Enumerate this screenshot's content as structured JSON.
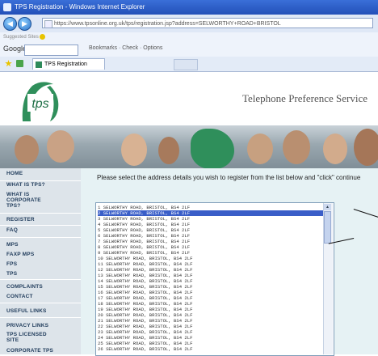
{
  "window": {
    "title": "TPS Registration - Windows Internet Explorer"
  },
  "browser": {
    "url": "https://www.tpsonline.org.uk/tps/registration.jsp?address=SELWORTHY+ROAD+BRISTOL",
    "links_label": "Suggested Sites",
    "google_label": "Google",
    "toolbar_items": "Bookmarks · Check · Options",
    "tab_title": "TPS Registration"
  },
  "site": {
    "logo_text": "tps",
    "title": "Telephone Preference Service"
  },
  "nav": {
    "items": [
      "HOME",
      "WHAT IS TPS?",
      "WHAT IS CORPORATE TPS?",
      "REGISTER",
      "FAQ",
      "MPS",
      "FAXP MPS",
      "FPS",
      "TPS",
      "COMPLAINTS",
      "CONTACT",
      "USEFUL LINKS",
      "PRIVACY LINKS",
      "TPS LICENSED SITE",
      "CORPORATE TPS"
    ]
  },
  "content": {
    "instruction": "Please select the address details you wish to register from the list below and \"click\" continue"
  },
  "address_list": {
    "selected_index": 1,
    "options": [
      "1 SELWORTHY ROAD, BRISTOL, BS4 2LF",
      "2 SELWORTHY ROAD, BRISTOL, BS4 2LF",
      "3 SELWORTHY ROAD, BRISTOL, BS4 2LF",
      "4 SELWORTHY ROAD, BRISTOL, BS4 2LF",
      "5 SELWORTHY ROAD, BRISTOL, BS4 2LF",
      "6 SELWORTHY ROAD, BRISTOL, BS4 2LF",
      "7 SELWORTHY ROAD, BRISTOL, BS4 2LF",
      "8 SELWORTHY ROAD, BRISTOL, BS4 2LF",
      "9 SELWORTHY ROAD, BRISTOL, BS4 2LF",
      "10 SELWORTHY ROAD, BRISTOL, BS4 2LF",
      "11 SELWORTHY ROAD, BRISTOL, BS4 2LF",
      "12 SELWORTHY ROAD, BRISTOL, BS4 2LF",
      "13 SELWORTHY ROAD, BRISTOL, BS4 2LF",
      "14 SELWORTHY ROAD, BRISTOL, BS4 2LF",
      "15 SELWORTHY ROAD, BRISTOL, BS4 2LF",
      "16 SELWORTHY ROAD, BRISTOL, BS4 2LF",
      "17 SELWORTHY ROAD, BRISTOL, BS4 2LF",
      "18 SELWORTHY ROAD, BRISTOL, BS4 2LF",
      "19 SELWORTHY ROAD, BRISTOL, BS4 2LF",
      "20 SELWORTHY ROAD, BRISTOL, BS4 2LF",
      "21 SELWORTHY ROAD, BRISTOL, BS4 2LF",
      "22 SELWORTHY ROAD, BRISTOL, BS4 2LF",
      "23 SELWORTHY ROAD, BRISTOL, BS4 2LF",
      "24 SELWORTHY ROAD, BRISTOL, BS4 2LF",
      "25 SELWORTHY ROAD, BRISTOL, BS4 2LF",
      "26 SELWORTHY ROAD, BRISTOL, BS4 2LF"
    ]
  },
  "colors": {
    "selected": "#3a5ec8",
    "sidebar": "#dde4ea",
    "content_bg": "#e6f2f4"
  }
}
